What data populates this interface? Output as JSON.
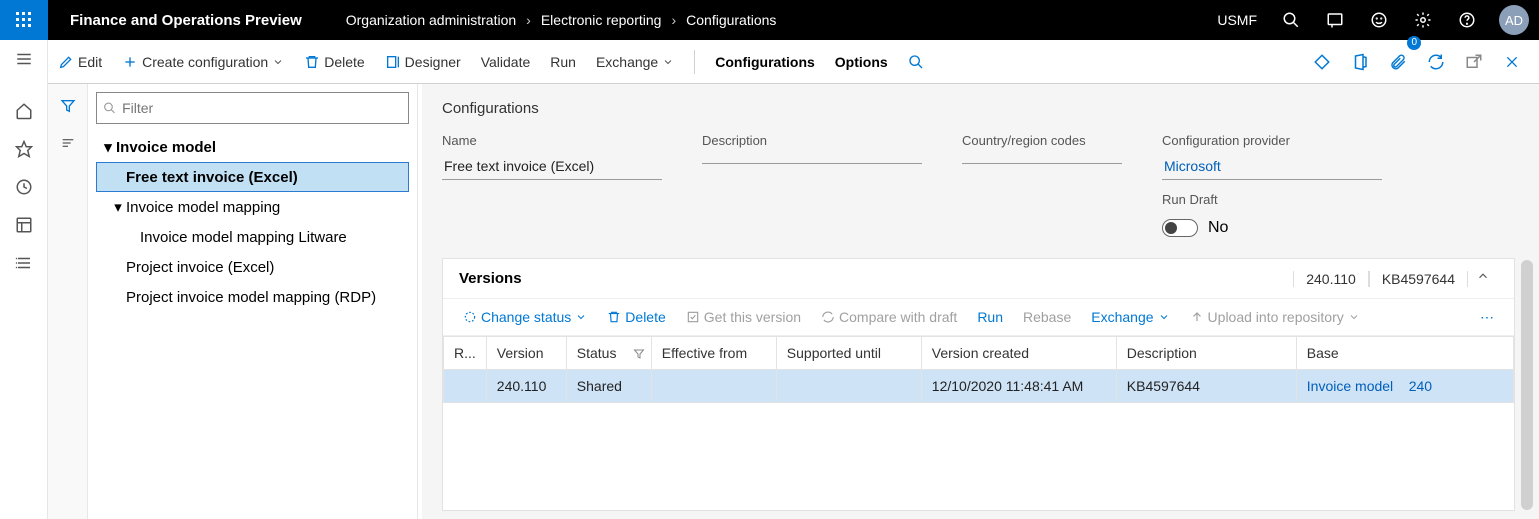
{
  "header": {
    "app_title": "Finance and Operations Preview",
    "breadcrumb": [
      "Organization administration",
      "Electronic reporting",
      "Configurations"
    ],
    "company": "USMF",
    "avatar": "AD"
  },
  "toolbar": {
    "edit": "Edit",
    "create": "Create configuration",
    "delete": "Delete",
    "designer": "Designer",
    "validate": "Validate",
    "run": "Run",
    "exchange": "Exchange",
    "configurations": "Configurations",
    "options": "Options",
    "attach_badge": "0"
  },
  "filter": {
    "placeholder": "Filter"
  },
  "tree": {
    "root": "Invoice model",
    "items": [
      "Free text invoice (Excel)",
      "Invoice model mapping",
      "Invoice model mapping Litware",
      "Project invoice (Excel)",
      "Project invoice model mapping (RDP)"
    ]
  },
  "details": {
    "heading": "Configurations",
    "labels": {
      "name": "Name",
      "description": "Description",
      "country": "Country/region codes",
      "provider": "Configuration provider",
      "run_draft": "Run Draft"
    },
    "values": {
      "name": "Free text invoice (Excel)",
      "description": "",
      "country": "",
      "provider": "Microsoft",
      "run_draft_text": "No"
    }
  },
  "versions": {
    "title": "Versions",
    "summary_version": "240.110",
    "summary_kb": "KB4597644",
    "toolbar": {
      "change_status": "Change status",
      "delete": "Delete",
      "get_this": "Get this version",
      "compare": "Compare with draft",
      "run": "Run",
      "rebase": "Rebase",
      "exchange": "Exchange",
      "upload": "Upload into repository"
    },
    "columns": {
      "r": "R...",
      "version": "Version",
      "status": "Status",
      "effective": "Effective from",
      "supported": "Supported until",
      "created": "Version created",
      "description": "Description",
      "base": "Base"
    },
    "row": {
      "version": "240.110",
      "status": "Shared",
      "effective": "",
      "supported": "",
      "created": "12/10/2020 11:48:41 AM",
      "description": "KB4597644",
      "base_name": "Invoice model",
      "base_num": "240"
    }
  }
}
